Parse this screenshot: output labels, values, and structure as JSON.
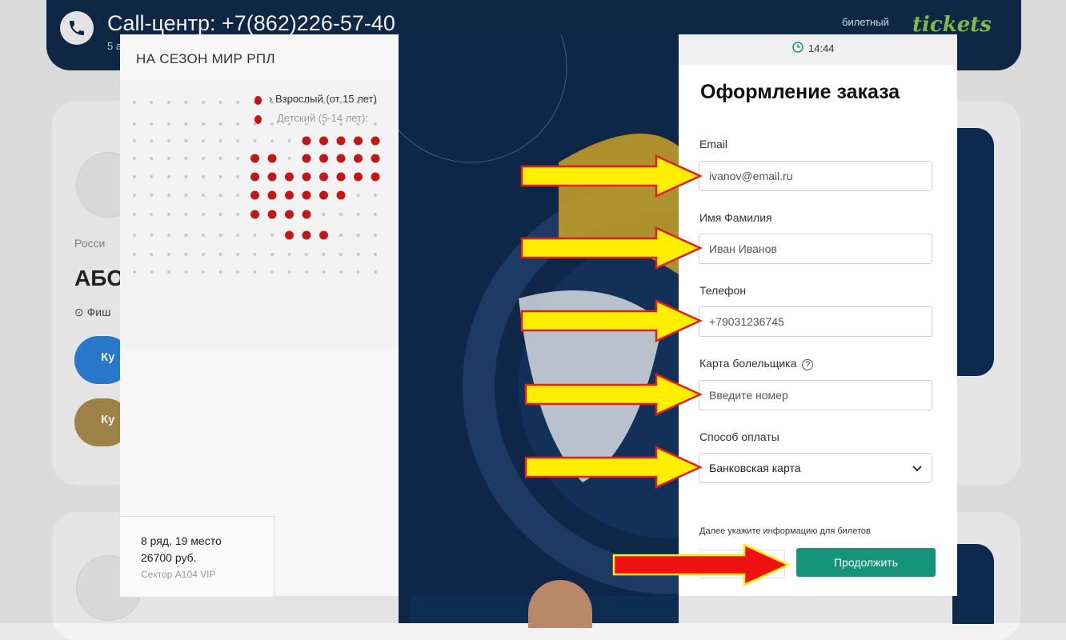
{
  "header": {
    "call_center": "Call-центр: +7(862)226-57-40",
    "call_sub": "5 а",
    "brand_small": "билетный",
    "brand_logo": "tickets"
  },
  "background_page": {
    "country": "Росси",
    "title": "АБО",
    "location": "Фиш",
    "buy_blue": "Ку",
    "buy_gold": "Ку"
  },
  "left_panel": {
    "title": "НА СЕЗОН МИР РПЛ",
    "legend_adult": "› Взрослый (от 15 лет)",
    "legend_child": "Детский (5-14 лет):",
    "seat_row": "8 ряд, 19 место",
    "seat_price": "26700 руб.",
    "seat_sector": "Сектор A104 VIP"
  },
  "modal": {
    "timer": "14:44",
    "title": "Оформление заказа",
    "email_label": "Email",
    "email_value": "ivanov@email.ru",
    "name_label": "Имя Фамилия",
    "name_placeholder": "Иван Иванов",
    "phone_label": "Телефон",
    "phone_value": "+79031236745",
    "card_label": "Карта болельщика",
    "card_placeholder": "Введите номер",
    "pay_label": "Способ оплаты",
    "pay_value": "Банковская карта",
    "hint": "Далее укажите информацию для билетов",
    "continue_label": "Продолжить"
  },
  "colors": {
    "accent_button": "#16947b",
    "arrow_yellow": "#ffee00",
    "arrow_red": "#ee1111",
    "header_bg": "#0e2a4a"
  },
  "icons": [
    "phone-icon",
    "clock-icon",
    "help-circle-icon",
    "chevron-down-icon",
    "location-pin-icon"
  ]
}
